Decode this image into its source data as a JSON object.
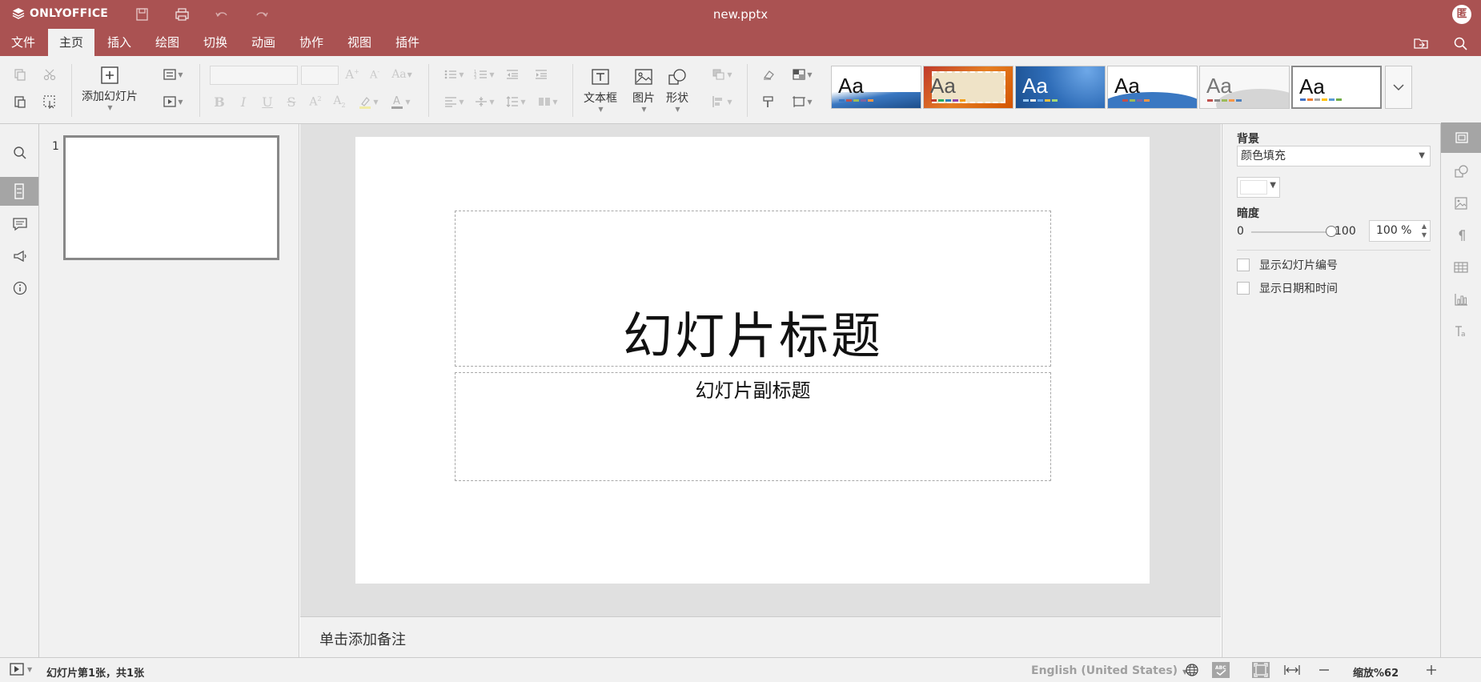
{
  "app": {
    "logo_text": "ONLYOFFICE",
    "doc_title": "new.pptx",
    "avatar_initial": "匿",
    "brand_color": "#aa5252"
  },
  "menu": {
    "tabs": [
      {
        "label": "文件",
        "active": false
      },
      {
        "label": "主页",
        "active": true
      },
      {
        "label": "插入",
        "active": false
      },
      {
        "label": "绘图",
        "active": false
      },
      {
        "label": "切换",
        "active": false
      },
      {
        "label": "动画",
        "active": false
      },
      {
        "label": "协作",
        "active": false
      },
      {
        "label": "视图",
        "active": false
      },
      {
        "label": "插件",
        "active": false
      }
    ],
    "right_icons": [
      "open-location-icon",
      "search-icon"
    ]
  },
  "toolbar": {
    "add_slide": "添加幻灯片",
    "text_box": "文本框",
    "picture": "图片",
    "shape": "形状",
    "themes": [
      {
        "name": "blank-blue",
        "label": "Aa",
        "bg": "#ffffff",
        "accent": "#3a78c2",
        "text": "#111111"
      },
      {
        "name": "stamp",
        "label": "Aa",
        "bg": "#d7b98a",
        "accent": "#c0392b",
        "text": "#333333"
      },
      {
        "name": "blue-dots",
        "label": "Aa",
        "bg": "#2f6db8",
        "accent": "#6ea8e8",
        "text": "#ffffff"
      },
      {
        "name": "white-wave",
        "label": "Aa",
        "bg": "#ffffff",
        "accent": "#3a78c2",
        "text": "#111111"
      },
      {
        "name": "gray-wave",
        "label": "Aa",
        "bg": "#f2f2f2",
        "accent": "#c8c8c8",
        "text": "#777777"
      },
      {
        "name": "office",
        "label": "Aa",
        "bg": "#ffffff",
        "accent": "#4472c4",
        "text": "#111111",
        "selected": true
      }
    ]
  },
  "thumbs": {
    "slide_number": "1"
  },
  "slide": {
    "title": "幻灯片标题",
    "subtitle": "幻灯片副标题"
  },
  "notes": {
    "placeholder": "单击添加备注"
  },
  "right_panel": {
    "background_label": "背景",
    "fill_type": "颜色填充",
    "fill_color": "#ffffff",
    "opacity_label": "暗度",
    "slider_min": "0",
    "slider_max": "100",
    "opacity_value": "100 %",
    "show_slide_number": "显示幻灯片编号",
    "show_date_time": "显示日期和时间"
  },
  "status": {
    "slide_info": "幻灯片第1张，共1张",
    "language": "English (United States)",
    "zoom": "缩放%62"
  }
}
